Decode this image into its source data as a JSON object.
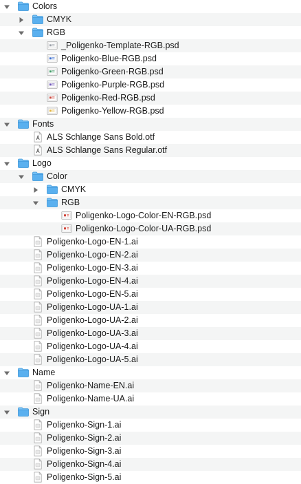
{
  "tree": [
    {
      "label": "Colors",
      "type": "folder",
      "expanded": true,
      "depth": 0
    },
    {
      "label": "CMYK",
      "type": "folder",
      "expanded": false,
      "depth": 1
    },
    {
      "label": "RGB",
      "type": "folder",
      "expanded": true,
      "depth": 1
    },
    {
      "label": "_Poligenko-Template-RGB.psd",
      "type": "psd",
      "swatch": "#9aa0a8",
      "depth": 2
    },
    {
      "label": "Poligenko-Blue-RGB.psd",
      "type": "psd",
      "swatch": "#3d6fd0",
      "depth": 2
    },
    {
      "label": "Poligenko-Green-RGB.psd",
      "type": "psd",
      "swatch": "#3f9a66",
      "depth": 2
    },
    {
      "label": "Poligenko-Purple-RGB.psd",
      "type": "psd",
      "swatch": "#6f55b8",
      "depth": 2
    },
    {
      "label": "Poligenko-Red-RGB.psd",
      "type": "psd",
      "swatch": "#c8453a",
      "depth": 2
    },
    {
      "label": "Poligenko-Yellow-RGB.psd",
      "type": "psd",
      "swatch": "#e2b33d",
      "depth": 2
    },
    {
      "label": "Fonts",
      "type": "folder",
      "expanded": true,
      "depth": 0
    },
    {
      "label": "ALS Schlange Sans Bold.otf",
      "type": "font",
      "depth": 1
    },
    {
      "label": "ALS Schlange Sans Regular.otf",
      "type": "font",
      "depth": 1
    },
    {
      "label": "Logo",
      "type": "folder",
      "expanded": true,
      "depth": 0
    },
    {
      "label": "Color",
      "type": "folder",
      "expanded": true,
      "depth": 1
    },
    {
      "label": "CMYK",
      "type": "folder",
      "expanded": false,
      "depth": 2
    },
    {
      "label": "RGB",
      "type": "folder",
      "expanded": true,
      "depth": 2
    },
    {
      "label": "Poligenko-Logo-Color-EN-RGB.psd",
      "type": "psd",
      "swatch": "#d0453a",
      "depth": 3
    },
    {
      "label": "Poligenko-Logo-Color-UA-RGB.psd",
      "type": "psd",
      "swatch": "#d0453a",
      "depth": 3
    },
    {
      "label": "Poligenko-Logo-EN-1.ai",
      "type": "ai",
      "depth": 1
    },
    {
      "label": "Poligenko-Logo-EN-2.ai",
      "type": "ai",
      "depth": 1
    },
    {
      "label": "Poligenko-Logo-EN-3.ai",
      "type": "ai",
      "depth": 1
    },
    {
      "label": "Poligenko-Logo-EN-4.ai",
      "type": "ai",
      "depth": 1
    },
    {
      "label": "Poligenko-Logo-EN-5.ai",
      "type": "ai",
      "depth": 1
    },
    {
      "label": "Poligenko-Logo-UA-1.ai",
      "type": "ai",
      "depth": 1
    },
    {
      "label": "Poligenko-Logo-UA-2.ai",
      "type": "ai",
      "depth": 1
    },
    {
      "label": "Poligenko-Logo-UA-3.ai",
      "type": "ai",
      "depth": 1
    },
    {
      "label": "Poligenko-Logo-UA-4.ai",
      "type": "ai",
      "depth": 1
    },
    {
      "label": "Poligenko-Logo-UA-5.ai",
      "type": "ai",
      "depth": 1
    },
    {
      "label": "Name",
      "type": "folder",
      "expanded": true,
      "depth": 0
    },
    {
      "label": "Poligenko-Name-EN.ai",
      "type": "ai",
      "depth": 1
    },
    {
      "label": "Poligenko-Name-UA.ai",
      "type": "ai",
      "depth": 1
    },
    {
      "label": "Sign",
      "type": "folder",
      "expanded": true,
      "depth": 0
    },
    {
      "label": "Poligenko-Sign-1.ai",
      "type": "ai",
      "depth": 1
    },
    {
      "label": "Poligenko-Sign-2.ai",
      "type": "ai",
      "depth": 1
    },
    {
      "label": "Poligenko-Sign-3.ai",
      "type": "ai",
      "depth": 1
    },
    {
      "label": "Poligenko-Sign-4.ai",
      "type": "ai",
      "depth": 1
    },
    {
      "label": "Poligenko-Sign-5.ai",
      "type": "ai",
      "depth": 1
    }
  ],
  "colors": {
    "folder": "#5ab0ef",
    "folder_tab": "#7cc4f6",
    "folder_edge": "#3d96d9",
    "disclosure": "#6c6c6c",
    "doc_fill": "#ffffff",
    "doc_edge": "#a8a8a8"
  }
}
